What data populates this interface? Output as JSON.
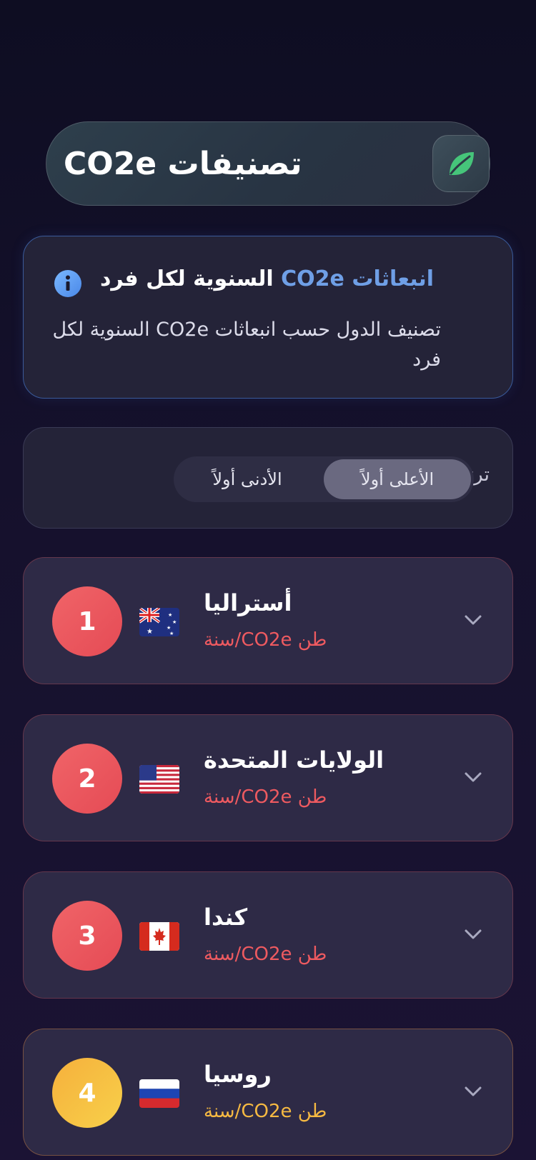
{
  "header": {
    "title": "تصنيفات CO2e",
    "logo_icon": "leaf-icon"
  },
  "info": {
    "heading_accent": "انبعاثات CO2e",
    "heading_rest": " السنوية لكل فرد",
    "icon": "info-icon",
    "description": "تصنيف الدول حسب انبعاثات CO2e السنوية لكل فرد"
  },
  "sort": {
    "label": "ترتيب حسب",
    "options": [
      "الأعلى أولاً",
      "الأدنى أولاً"
    ],
    "selected": "الأعلى أولاً"
  },
  "rankings": [
    {
      "rank": "1",
      "name": "أستراليا",
      "unit": "طن CO2e/سنة",
      "flag": "australia-flag"
    },
    {
      "rank": "2",
      "name": "الولايات المتحدة",
      "unit": "طن CO2e/سنة",
      "flag": "usa-flag"
    },
    {
      "rank": "3",
      "name": "كندا",
      "unit": "طن CO2e/سنة",
      "flag": "canada-flag"
    },
    {
      "rank": "4",
      "name": "روسيا",
      "unit": "طن CO2e/سنة",
      "flag": "russia-flag"
    }
  ],
  "colors": {
    "accent_blue": "#6f9fe6",
    "rank_red": "#ee5a60",
    "rank_gold": "#f5b942"
  }
}
